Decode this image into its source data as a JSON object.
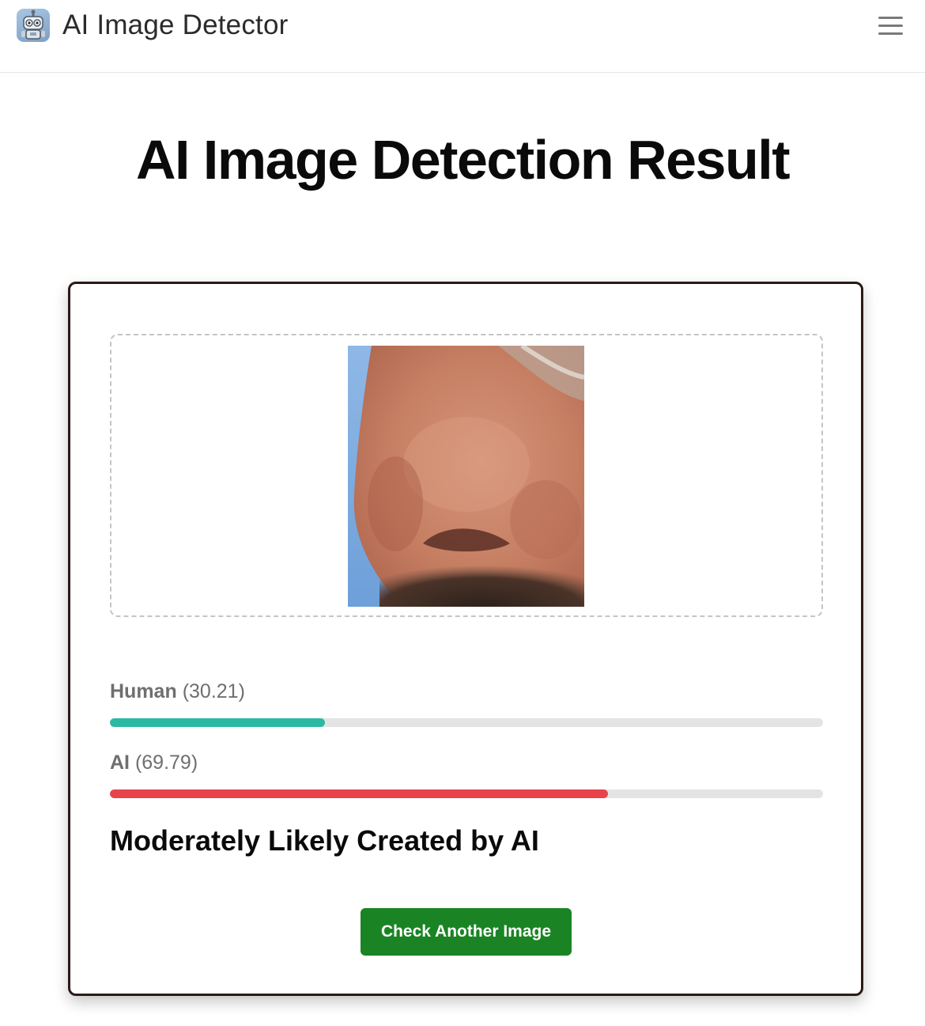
{
  "header": {
    "app_name": "AI Image Detector",
    "logo_icon": "robot-icon",
    "menu_icon": "hamburger-menu-icon"
  },
  "page": {
    "title": "AI Image Detection Result"
  },
  "result": {
    "image_description": "close-up photo of a nose",
    "scores": [
      {
        "label": "Human",
        "value_text": "(30.21)",
        "value": 30.21,
        "color": "#2cb9a4"
      },
      {
        "label": "AI",
        "value_text": "(69.79)",
        "value": 69.79,
        "color": "#e8434b"
      }
    ],
    "verdict": "Moderately Likely Created by AI",
    "button_label": "Check Another Image",
    "button_color": "#1a8424"
  }
}
